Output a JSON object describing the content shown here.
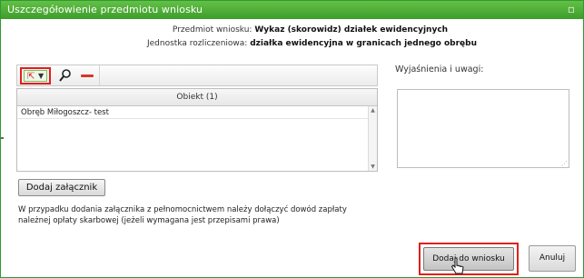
{
  "window": {
    "title": "Uszczegółowienie przedmiotu wniosku",
    "close_icon": "close-icon"
  },
  "info": {
    "subject_label": "Przedmiot wniosku:",
    "subject_value": "Wykaz (skorowidz) działek ewidencyjnych",
    "unit_label": "Jednostka rozliczeniowa:",
    "unit_value": "działka ewidencyjna w granicach jednego obrębu"
  },
  "toolbar": {
    "add_icon": "add-object-dropdown-icon",
    "search_icon": "search-icon",
    "remove_icon": "remove-icon"
  },
  "grid": {
    "header": "Obiekt (1)",
    "rows": [
      "Obręb Miłogoszcz- test"
    ]
  },
  "attach_button": "Dodaj załącznik",
  "note": "W przypadku dodania załącznika z pełnomocnictwem należy dołączyć dowód zapłaty należnej opłaty skarbowej (jeżeli wymagana jest przepisami prawa)",
  "remarks": {
    "label": "Wyjaśnienia i uwagi:",
    "value": ""
  },
  "buttons": {
    "add_to_request": "Dodaj do wniosku",
    "cancel": "Anuluj"
  },
  "colors": {
    "titlebar": "#4caf32",
    "highlight": "#e0201a",
    "remove": "#d9362b"
  }
}
